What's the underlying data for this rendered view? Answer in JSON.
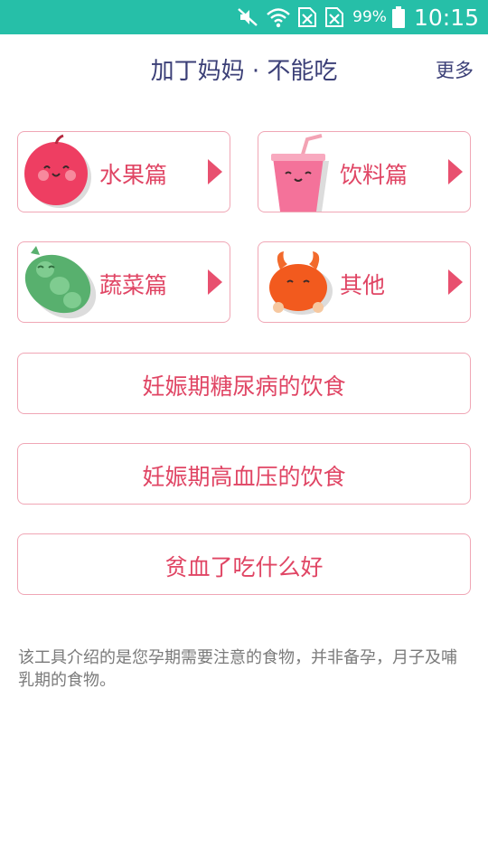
{
  "status_bar": {
    "battery_percent": "99%",
    "time": "10:15",
    "icons": [
      "mute-icon",
      "wifi-icon",
      "no-sim-icon",
      "no-sim-icon",
      "battery-icon"
    ]
  },
  "header": {
    "title": "加丁妈妈 · 不能吃",
    "more": "更多"
  },
  "categories": [
    {
      "label": "水果篇",
      "icon": "apple-icon"
    },
    {
      "label": "饮料篇",
      "icon": "drink-cup-icon"
    },
    {
      "label": "蔬菜篇",
      "icon": "pea-pod-icon"
    },
    {
      "label": "其他",
      "icon": "crab-icon"
    }
  ],
  "topics": [
    {
      "label": "妊娠期糖尿病的饮食"
    },
    {
      "label": "妊娠期高血压的饮食"
    },
    {
      "label": "贫血了吃什么好"
    }
  ],
  "footnote": "该工具介绍的是您孕期需要注意的食物，并非备孕，月子及哺乳期的食物。",
  "colors": {
    "status_bar": "#26bfa8",
    "title": "#3b3f77",
    "accent": "#e04564",
    "card_border": "#f0a6b5",
    "footnote": "#7a7a7a"
  }
}
